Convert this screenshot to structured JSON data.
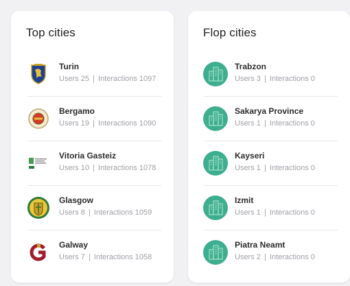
{
  "colors": {
    "page_bg": "#f1f1f3",
    "card_bg": "#ffffff",
    "title": "#222222",
    "meta": "#a0a0a8",
    "city_placeholder": "#3dae8f"
  },
  "top": {
    "title": "Top cities",
    "cities": [
      {
        "name": "Turin",
        "users_label": "Users 25",
        "interactions_label": "Interactions 1097",
        "icon": "turin-crest-icon"
      },
      {
        "name": "Bergamo",
        "users_label": "Users 19",
        "interactions_label": "Interactions 1090",
        "icon": "bergamo-seal-icon"
      },
      {
        "name": "Vitoria Gasteiz",
        "users_label": "Users 10",
        "interactions_label": "Interactions 1078",
        "icon": "vitoria-gasteiz-logo-icon"
      },
      {
        "name": "Glasgow",
        "users_label": "Users 8",
        "interactions_label": "Interactions 1059",
        "icon": "glasgow-crest-icon"
      },
      {
        "name": "Galway",
        "users_label": "Users 7",
        "interactions_label": "Interactions 1058",
        "icon": "galway-logo-icon"
      }
    ]
  },
  "flop": {
    "title": "Flop cities",
    "cities": [
      {
        "name": "Trabzon",
        "users_label": "Users 3",
        "interactions_label": "Interactions 0",
        "icon": "city-buildings-icon"
      },
      {
        "name": "Sakarya Province",
        "users_label": "Users 1",
        "interactions_label": "Interactions 0",
        "icon": "city-buildings-icon"
      },
      {
        "name": "Kayseri",
        "users_label": "Users 1",
        "interactions_label": "Interactions 0",
        "icon": "city-buildings-icon"
      },
      {
        "name": "Izmit",
        "users_label": "Users 1",
        "interactions_label": "Interactions 0",
        "icon": "city-buildings-icon"
      },
      {
        "name": "Piatra Neamt",
        "users_label": "Users 2",
        "interactions_label": "Interactions 0",
        "icon": "city-buildings-icon"
      }
    ]
  },
  "separator": "|"
}
